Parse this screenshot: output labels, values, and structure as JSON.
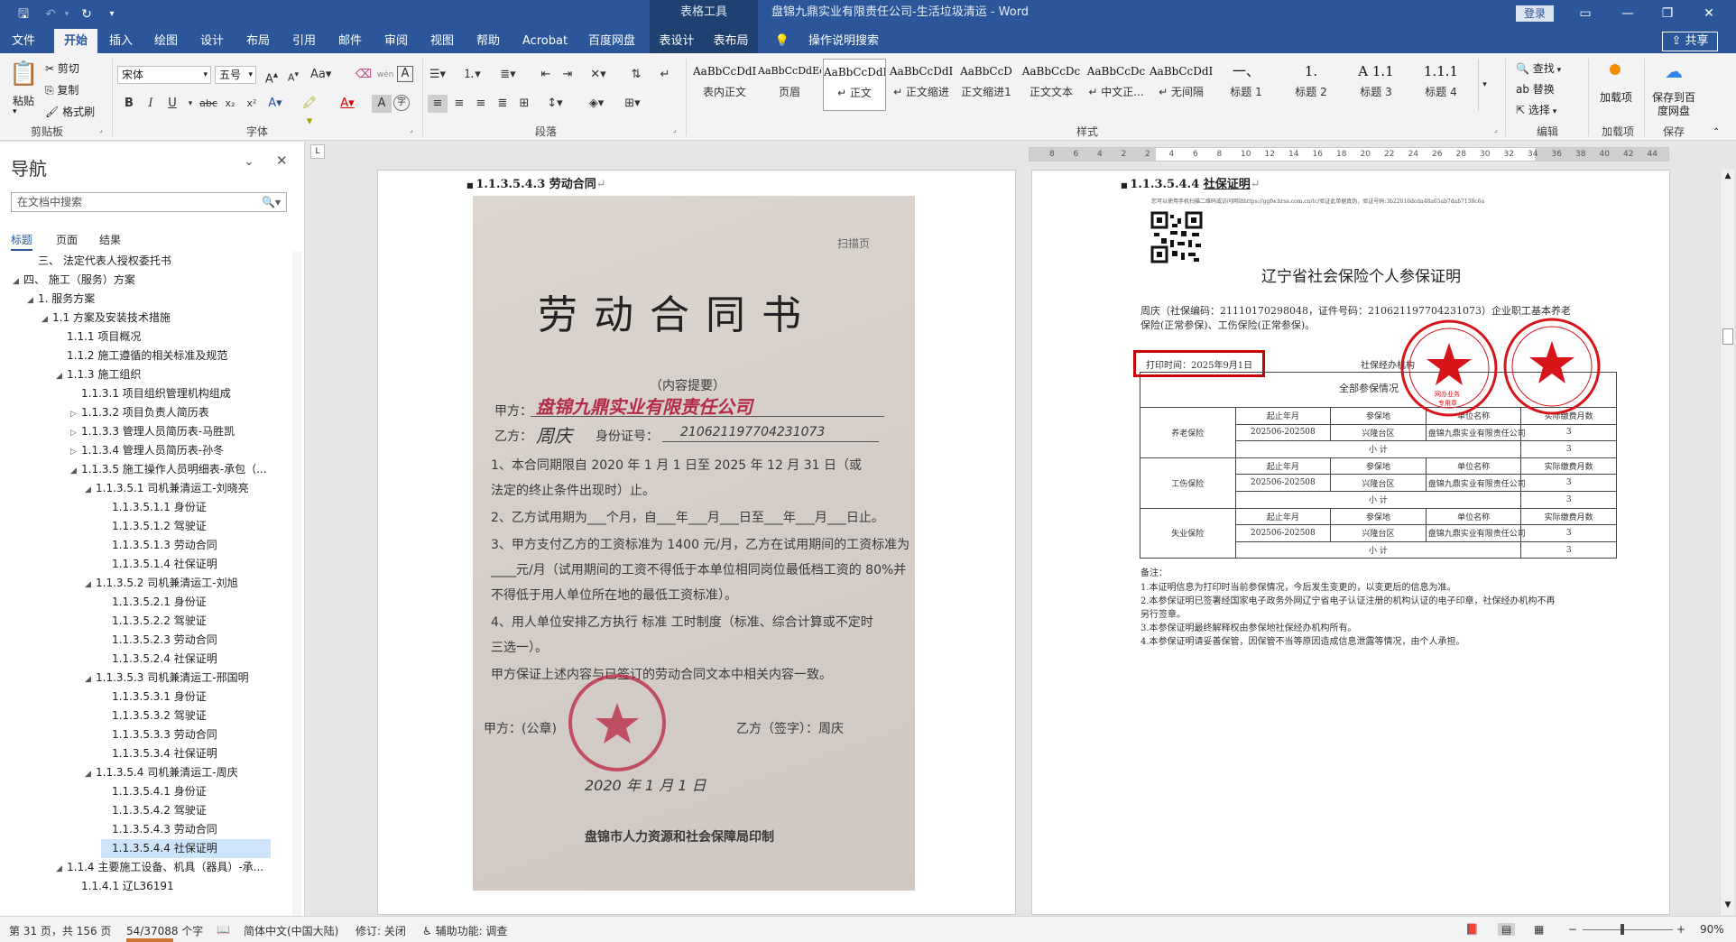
{
  "window": {
    "context_group": "表格工具",
    "document_title": "盘锦九鼎实业有限责任公司-生活垃圾清运 - Word",
    "login": "登录"
  },
  "tabs": [
    "文件",
    "开始",
    "插入",
    "绘图",
    "设计",
    "布局",
    "引用",
    "邮件",
    "审阅",
    "视图",
    "帮助",
    "Acrobat",
    "百度网盘",
    "表设计",
    "表布局"
  ],
  "tell_me": "操作说明搜索",
  "share": "共享",
  "ribbon": {
    "clipboard": {
      "paste": "粘贴",
      "cut": "剪切",
      "copy": "复制",
      "format_painter": "格式刷",
      "label": "剪贴板"
    },
    "font": {
      "name": "宋体",
      "size": "五号",
      "label": "字体"
    },
    "paragraph": {
      "label": "段落"
    },
    "styles": {
      "label": "样式",
      "items": [
        {
          "sample": "AaBbCcDdI",
          "name": "表内正文"
        },
        {
          "sample": "AaBbCcDdEe",
          "name": "页眉"
        },
        {
          "sample": "AaBbCcDdI",
          "name": "↵ 正文"
        },
        {
          "sample": "AaBbCcDdI",
          "name": "↵ 正文缩进"
        },
        {
          "sample": "AaBbCcD",
          "name": "正文缩进1"
        },
        {
          "sample": "AaBbCcDc",
          "name": "正文文本"
        },
        {
          "sample": "AaBbCcDc",
          "name": "↵ 中文正..."
        },
        {
          "sample": "AaBbCcDdI",
          "name": "↵ 无间隔"
        },
        {
          "sample": "一、",
          "name": "标题 1"
        },
        {
          "sample": "1.",
          "name": "标题 2"
        },
        {
          "sample": "A 1.1",
          "name": "标题 3"
        },
        {
          "sample": "1.1.1",
          "name": "标题 4"
        }
      ]
    },
    "editing": {
      "find": "查找",
      "replace": "替换",
      "select": "选择",
      "label": "编辑"
    },
    "addins": {
      "button": "加载项",
      "label": "加载项"
    },
    "save": {
      "button": "保存到百度网盘",
      "label": "保存"
    }
  },
  "nav": {
    "title": "导航",
    "search_placeholder": "在文档中搜索",
    "tabs": [
      "标题",
      "页面",
      "结果"
    ],
    "items": [
      {
        "text": "三、 法定代表人授权委托书",
        "level": 1,
        "tri": ""
      },
      {
        "text": "四、 施工（服务）方案",
        "level": 0,
        "tri": "▲"
      },
      {
        "text": "1. 服务方案",
        "level": 1,
        "tri": "▲"
      },
      {
        "text": "1.1 方案及安装技术措施",
        "level": 2,
        "tri": "▲"
      },
      {
        "text": "1.1.1 项目概况",
        "level": 3,
        "tri": ""
      },
      {
        "text": "1.1.2 施工遵循的相关标准及规范",
        "level": 3,
        "tri": ""
      },
      {
        "text": "1.1.3 施工组织",
        "level": 3,
        "tri": "▲"
      },
      {
        "text": "1.1.3.1 项目组织管理机构组成",
        "level": 4,
        "tri": ""
      },
      {
        "text": "1.1.3.2 项目负责人简历表",
        "level": 4,
        "tri": "▷"
      },
      {
        "text": "1.1.3.3 管理人员简历表-马胜凯",
        "level": 4,
        "tri": "▷"
      },
      {
        "text": "1.1.3.4 管理人员简历表-孙冬",
        "level": 4,
        "tri": "▷"
      },
      {
        "text": "1.1.3.5 施工操作人员明细表-承包（...",
        "level": 4,
        "tri": "▲"
      },
      {
        "text": "1.1.3.5.1 司机兼清运工-刘晓亮",
        "level": 5,
        "tri": "▲"
      },
      {
        "text": "1.1.3.5.1.1 身份证",
        "level": 6,
        "tri": ""
      },
      {
        "text": "1.1.3.5.1.2 驾驶证",
        "level": 6,
        "tri": ""
      },
      {
        "text": "1.1.3.5.1.3 劳动合同",
        "level": 6,
        "tri": ""
      },
      {
        "text": "1.1.3.5.1.4 社保证明",
        "level": 6,
        "tri": ""
      },
      {
        "text": "1.1.3.5.2 司机兼清运工-刘旭",
        "level": 5,
        "tri": "▲"
      },
      {
        "text": "1.1.3.5.2.1 身份证",
        "level": 6,
        "tri": ""
      },
      {
        "text": "1.1.3.5.2.2 驾驶证",
        "level": 6,
        "tri": ""
      },
      {
        "text": "1.1.3.5.2.3 劳动合同",
        "level": 6,
        "tri": ""
      },
      {
        "text": "1.1.3.5.2.4 社保证明",
        "level": 6,
        "tri": ""
      },
      {
        "text": "1.1.3.5.3 司机兼清运工-邢国明",
        "level": 5,
        "tri": "▲"
      },
      {
        "text": "1.1.3.5.3.1 身份证",
        "level": 6,
        "tri": ""
      },
      {
        "text": "1.1.3.5.3.2 驾驶证",
        "level": 6,
        "tri": ""
      },
      {
        "text": "1.1.3.5.3.3 劳动合同",
        "level": 6,
        "tri": ""
      },
      {
        "text": "1.1.3.5.3.4 社保证明",
        "level": 6,
        "tri": ""
      },
      {
        "text": "1.1.3.5.4 司机兼清运工-周庆",
        "level": 5,
        "tri": "▲"
      },
      {
        "text": "1.1.3.5.4.1 身份证",
        "level": 6,
        "tri": ""
      },
      {
        "text": "1.1.3.5.4.2 驾驶证",
        "level": 6,
        "tri": ""
      },
      {
        "text": "1.1.3.5.4.3 劳动合同",
        "level": 6,
        "tri": ""
      },
      {
        "text": "1.1.3.5.4.4 社保证明",
        "level": 6,
        "tri": "",
        "current": true
      },
      {
        "text": "1.1.4 主要施工设备、机具（器具）-承...",
        "level": 3,
        "tri": "▲"
      },
      {
        "text": "1.1.4.1 辽L36191",
        "level": 4,
        "tri": ""
      }
    ]
  },
  "left_page": {
    "heading_num": "1.1.3.5.4.3",
    "heading_text": "劳动合同",
    "scan": {
      "stamp_note": "扫描页",
      "title": "劳 动 合 同 书",
      "subtitle": "（内容提要）",
      "party_a_label": "甲方：",
      "party_a_hand": "盘锦九鼎实业有限责任公司",
      "party_b_label": "乙方：",
      "party_b_hand": "周庆",
      "id_label": "身份证号：",
      "id_hand": "210621197704231073",
      "clause1": "1、本合同期限自 2020 年  1  月  1  日至 2025 年  12  月  31  日（或",
      "clause1b": "法定的终止条件出现时）止。",
      "clause2": "2、乙方试用期为___个月，自___年___月___日至___年___月___日止。",
      "clause3": "3、甲方支付乙方的工资标准为 1400 元/月，乙方在试用期间的工资标准为",
      "clause3b": "____元/月（试用期间的工资不得低于本单位相同岗位最低档工资的 80%并",
      "clause3c": "不得低于用人单位所在地的最低工资标准）。",
      "clause4": "4、用人单位安排乙方执行  标准  工时制度（标准、综合计算或不定时",
      "clause4b": "三选一）。",
      "guarantee": "甲方保证上述内容与已签订的劳动合同文本中相关内容一致。",
      "sign_a": "甲方：(公章)",
      "sign_b": "乙方（签字）：周庆",
      "date": "2020 年  1  月  1  日",
      "printer": "盘锦市人力资源和社会保障局印制"
    }
  },
  "right_page": {
    "heading_num": "1.1.3.5.4.4",
    "heading_text": "社保证明",
    "cert": {
      "verify_note": "您可以使用手机扫描二维码或访问网站https://ggfw.hrss.com.cn/tc/验证此单据真伪，验证号码:3b22016dcda48a65ab7dab7138c6a",
      "title": "辽宁省社会保险个人参保证明",
      "person": "周庆（社保编码：21110170298048，证件号码：210621197704231073）企业职工基本养老",
      "person2": "保险(正常参保)、工伤保险(正常参保)。",
      "print_time": "打印时间：2025年9月1日",
      "agency": "社保经办机构",
      "table_caption": "全部参保情况",
      "table_headers": [
        "起止年月",
        "参保地",
        "单位名称",
        "实际缴费月数"
      ],
      "rows": [
        {
          "type": "养老保险",
          "period": "202506-202508",
          "place": "兴隆台区",
          "company": "盘锦九鼎实业有限责任公司",
          "months": "3"
        },
        {
          "type": "工伤保险",
          "period": "202506-202508",
          "place": "兴隆台区",
          "company": "盘锦九鼎实业有限责任公司",
          "months": "3"
        },
        {
          "type": "失业保险",
          "period": "202506-202508",
          "place": "兴隆台区",
          "company": "盘锦九鼎实业有限责任公司",
          "months": "3"
        }
      ],
      "subtotal_label": "小    计",
      "subtotal": "3",
      "notes_title": "备注：",
      "notes": [
        "1.本证明信息为打印时当前参保情况，今后发生变更的，以变更后的信息为准。",
        "2.本参保证明已签署经国家电子政务外网辽宁省电子认证注册的机构认证的电子印章，社保经办机构不再",
        "另行签章。",
        "3.本参保证明最终解释权由参保地社保经办机构所有。",
        "4.本参保证明请妥善保管，因保管不当等原因造成信息泄露等情况，由个人承担。"
      ],
      "seal1_text": "网办业务",
      "seal1_text2": "专用章"
    }
  },
  "status": {
    "page": "第 31 页，共 156 页",
    "words": "54/37088 个字",
    "language": "简体中文(中国大陆)",
    "track": "修订: 关闭",
    "accessibility": "辅助功能: 调查",
    "zoom": "90%"
  },
  "ruler_numbers": [
    "8",
    "6",
    "4",
    "2",
    "2",
    "4",
    "6",
    "8",
    "10",
    "12",
    "14",
    "16",
    "18",
    "20",
    "22",
    "24",
    "26",
    "28",
    "30",
    "32",
    "34",
    "36",
    "38",
    "40",
    "42",
    "44"
  ],
  "colors": {
    "word_blue": "#2b579a",
    "context_dark": "#1f4172",
    "seal_red": "#d7141a",
    "highlight_box": "#cc0000"
  }
}
